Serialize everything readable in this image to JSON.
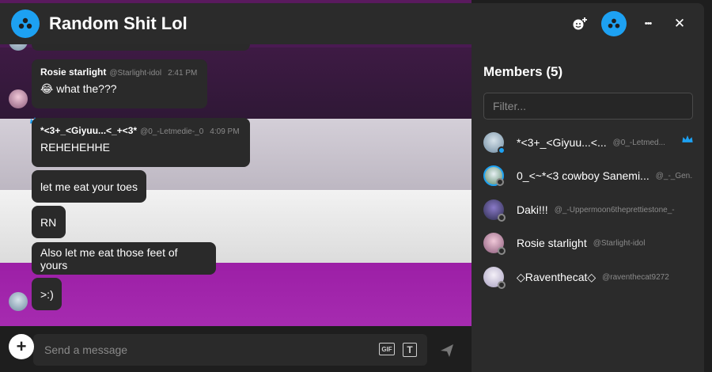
{
  "header": {
    "title": "Random Shit Lol",
    "icons": [
      "group-avatar-icon",
      "add-emoji-icon",
      "group-avatar-icon",
      "more-icon",
      "close-icon"
    ],
    "more_glyph": "•••",
    "close_glyph": "✕"
  },
  "messages": [
    {
      "author": "Rosie starlight",
      "handle": "@Starlight-idol",
      "time": "2:41 PM",
      "text": "😂 what the???"
    },
    {
      "author": "*<3+_<Giyuu...<_+<3*",
      "handle": "@0_-Letmedie-_0",
      "time": "4:09 PM",
      "text": "REHEHEHHE"
    },
    {
      "text": "let me eat your toes"
    },
    {
      "text": "RN"
    },
    {
      "text": "Also let me eat those feet of yours"
    },
    {
      "text": ">:)"
    }
  ],
  "composer": {
    "add_glyph": "+",
    "placeholder": "Send a message",
    "gif_label": "GIF",
    "text_label": "T"
  },
  "members": {
    "title": "Members (5)",
    "filter_placeholder": "Filter...",
    "list": [
      {
        "name": "*<3+_<Giyuu...<...",
        "handle": "@0_-Letmed...",
        "status": "online",
        "owner": true
      },
      {
        "name": "0_<~*<3 cowboy Sanemi...",
        "handle": "@_-_Gen...",
        "status": "offline",
        "owner": false
      },
      {
        "name": "Daki!!!",
        "handle": "@_-Uppermoon6theprettiestone_-",
        "status": "offline",
        "owner": false
      },
      {
        "name": "Rosie starlight",
        "handle": "@Starlight-idol",
        "status": "offline",
        "owner": false
      },
      {
        "name": "◇Raventhecat◇",
        "handle": "@raventhecat9272",
        "status": "offline",
        "owner": false
      }
    ]
  },
  "colors": {
    "accent": "#1da1f2",
    "panel": "#2b2b2b",
    "bubble": "#2a2a2a",
    "online": "#1da1f2",
    "crown": "#1da1f2"
  }
}
